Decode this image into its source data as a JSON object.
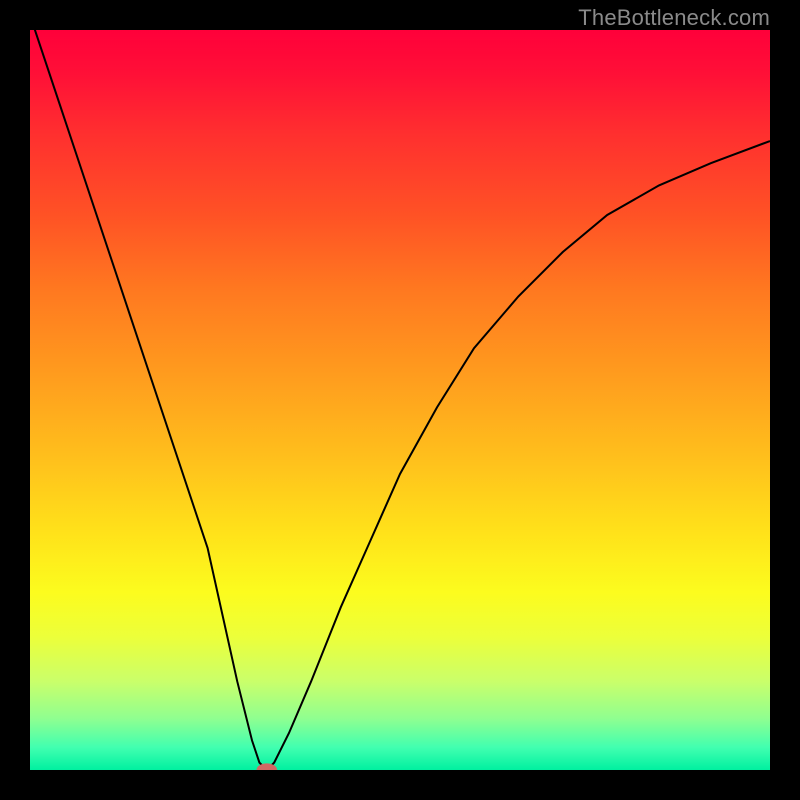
{
  "watermark": "TheBottleneck.com",
  "chart_data": {
    "type": "line",
    "title": "",
    "xlabel": "",
    "ylabel": "",
    "xlim": [
      0,
      100
    ],
    "ylim": [
      0,
      100
    ],
    "grid": false,
    "legend": false,
    "background_gradient": {
      "top_color": "#ff003a",
      "bottom_color": "#00f0a0"
    },
    "series": [
      {
        "name": "bottleneck-curve",
        "color": "#000000",
        "x": [
          0,
          4,
          8,
          12,
          16,
          20,
          24,
          28,
          30,
          31,
          32,
          33,
          35,
          38,
          42,
          46,
          50,
          55,
          60,
          66,
          72,
          78,
          85,
          92,
          100
        ],
        "y": [
          102,
          90,
          78,
          66,
          54,
          42,
          30,
          12,
          4,
          1,
          0,
          1,
          5,
          12,
          22,
          31,
          40,
          49,
          57,
          64,
          70,
          75,
          79,
          82,
          85
        ]
      }
    ],
    "marker": {
      "shape": "ellipse",
      "color": "#d06a64",
      "cx": 32,
      "cy": 0,
      "rx": 1.4,
      "ry": 0.9
    }
  }
}
